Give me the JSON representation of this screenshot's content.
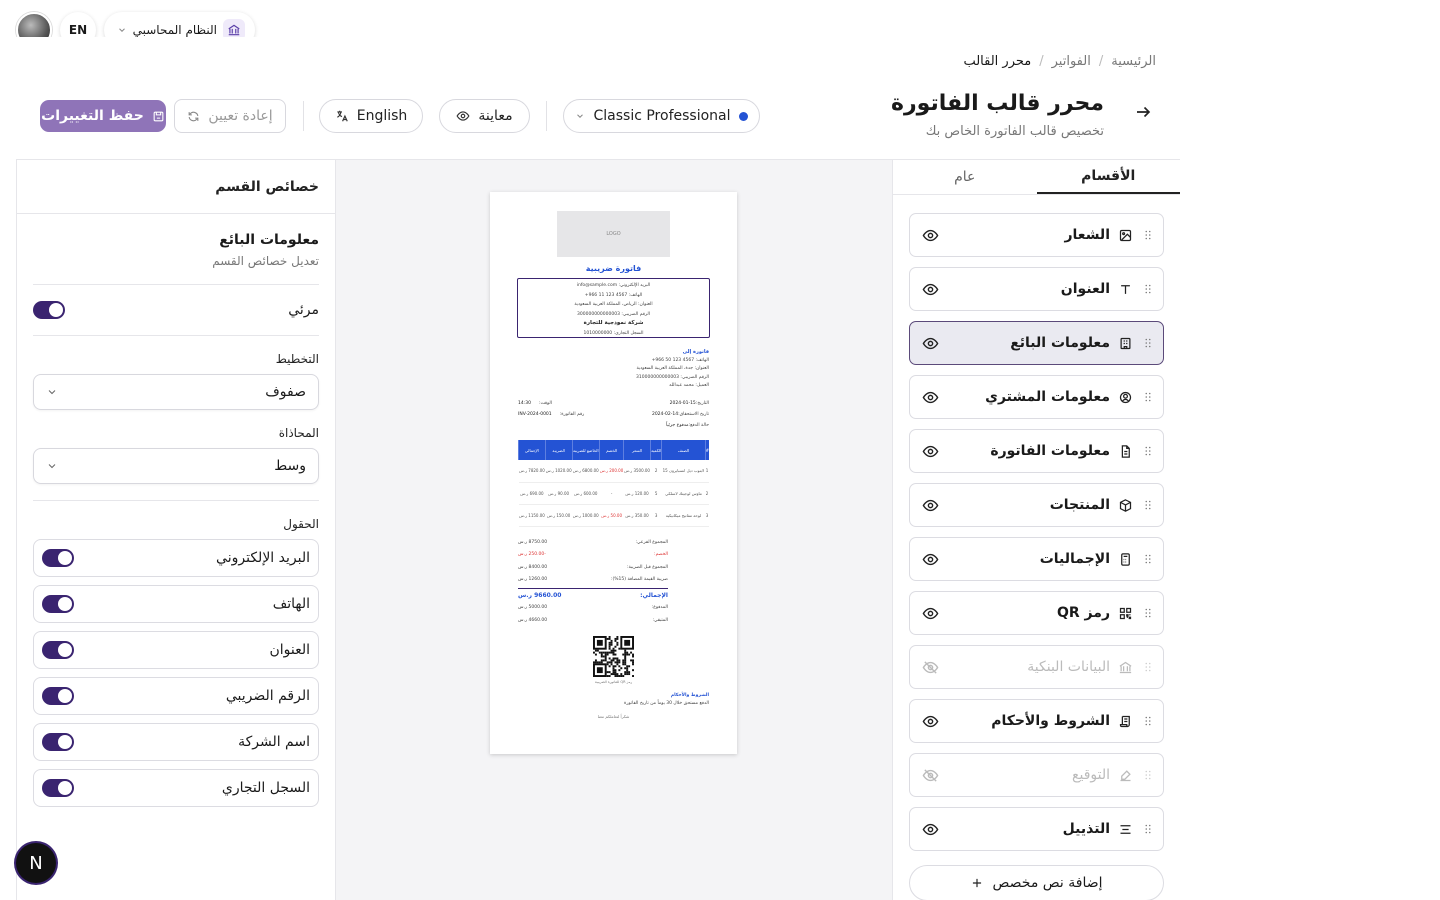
{
  "topbar": {
    "lang_code": "EN",
    "system_name": "النظام المحاسبي"
  },
  "breadcrumb": {
    "home": "الرئيسية",
    "invoices": "الفواتير",
    "current": "محرر القالب",
    "sep": "/"
  },
  "header": {
    "title": "محرر قالب الفاتورة",
    "subtitle": "تخصيص قالب الفاتورة الخاص بك"
  },
  "toolbar": {
    "template_name": "Classic Professional",
    "preview_label": "معاينة",
    "language_label": "English",
    "reset_label": "إعادة تعيين",
    "save_label": "حفظ التغييرات"
  },
  "colors": {
    "accent": "#3a2470",
    "primary_blue": "#2453d4",
    "save_bg": "#8f74b8"
  },
  "left_panel": {
    "header": "خصائص القسم",
    "section_title": "معلومات البائع",
    "section_sub": "تعديل خصائص القسم",
    "visible_label": "مرئي",
    "visible": true,
    "layout_label": "التخطيط",
    "layout_value": "صفوف",
    "align_label": "المحاذاة",
    "align_value": "وسط",
    "fields_label": "الحقول",
    "fields": [
      {
        "label": "البريد الإلكتروني",
        "on": true
      },
      {
        "label": "الهاتف",
        "on": true
      },
      {
        "label": "العنوان",
        "on": true
      },
      {
        "label": "الرقم الضريبي",
        "on": true
      },
      {
        "label": "اسم الشركة",
        "on": true
      },
      {
        "label": "السجل التجاري",
        "on": true
      }
    ]
  },
  "invoice": {
    "logo_text": "LOGO",
    "title": "فاتورة ضريبية",
    "seller": {
      "email": "البريد الإلكتروني: info@sample.com",
      "phone": "الهاتف: 4567 123 11 966+",
      "address": "العنوان: الرياض، المملكة العربية السعودية",
      "tax": "الرقم الضريبي: 300000000000003",
      "company": "شركة نموذجية للتجارة",
      "cr": "السجل التجاري: 1010000000"
    },
    "bill_to": {
      "heading": "فاتورة إلى",
      "phone": "الهاتف: 4567 123 50 966+",
      "address": "العنوان: جدة، المملكة العربية السعودية",
      "tax": "الرقم الضريبي: 310000000000003",
      "client": "العميل: محمد عبدالله"
    },
    "meta": [
      {
        "k": "التاريخ:",
        "v": "2024-01-15",
        "k2": "الوقت:",
        "v2": "14:30"
      },
      {
        "k": "تاريخ الاستحقاق:",
        "v": "2024-02-14",
        "k2": "رقم الفاتورة:",
        "v2": "INV-2024-0001"
      },
      {
        "k": "حالة الدفع:",
        "v": "مدفوع جزئياً",
        "k2": "",
        "v2": ""
      }
    ],
    "table_headers": [
      "#",
      "الصنف",
      "الكمية",
      "السعر",
      "الخصم",
      "الخاضع للضريبة",
      "الضريبة",
      "الإجمالي"
    ],
    "rows": [
      [
        "1",
        "لابتوب ديل انسبايرون 15",
        "2",
        "3500.00 ر.س",
        "200.00 ر.س",
        "6800.00 ر.س",
        "1020.00 ر.س",
        "7820.00 ر.س"
      ],
      [
        "2",
        "ماوس لوجيتك لاسلكي",
        "5",
        "120.00 ر.س",
        "-",
        "600.00 ر.س",
        "90.00 ر.س",
        "690.00 ر.س"
      ],
      [
        "3",
        "لوحة مفاتيح ميكانيكية",
        "3",
        "350.00 ر.س",
        "50.00 ر.س",
        "1000.00 ر.س",
        "150.00 ر.س",
        "1150.00 ر.س"
      ]
    ],
    "totals": [
      {
        "k": "المجموع الفرعي:",
        "v": "8750.00 ر.س"
      },
      {
        "k": "الخصم:",
        "v": "-250.00 ر.س"
      },
      {
        "k": "المجموع قبل الضريبة:",
        "v": "8400.00 ر.س"
      },
      {
        "k": "ضريبة القيمة المضافة (15%):",
        "v": "1260.00 ر.س"
      }
    ],
    "grand": {
      "k": "الإجمالي:",
      "v": "9660.00 ر.س"
    },
    "paid": {
      "k": "المدفوع:",
      "v": "5000.00 ر.س"
    },
    "remaining": {
      "k": "المتبقي:",
      "v": "4660.00 ر.س"
    },
    "qr_caption": "رمز QR للفاتورة الضريبية",
    "terms_heading": "الشروط والأحكام",
    "terms_text": "الدفع مستحق خلال 30 يوماً من تاريخ الفاتورة",
    "thanks": "شكراً لتعاملكم معنا"
  },
  "right_panel": {
    "tab_general": "عام",
    "tab_sections": "الأقسام",
    "sections": [
      {
        "label": "الشعار",
        "icon": "image-icon",
        "visible": true
      },
      {
        "label": "العنوان",
        "icon": "type-icon",
        "visible": true
      },
      {
        "label": "معلومات البائع",
        "icon": "building-icon",
        "visible": true,
        "selected": true
      },
      {
        "label": "معلومات المشتري",
        "icon": "user-circle-icon",
        "visible": true
      },
      {
        "label": "معلومات الفاتورة",
        "icon": "document-icon",
        "visible": true
      },
      {
        "label": "المنتجات",
        "icon": "box-icon",
        "visible": true
      },
      {
        "label": "الإجماليات",
        "icon": "calculator-icon",
        "visible": true
      },
      {
        "label": "رمز QR",
        "icon": "qr-icon",
        "visible": true
      },
      {
        "label": "البيانات البنكية",
        "icon": "bank-icon",
        "visible": false
      },
      {
        "label": "الشروط والأحكام",
        "icon": "scroll-icon",
        "visible": true
      },
      {
        "label": "التوقيع",
        "icon": "signature-icon",
        "visible": false
      },
      {
        "label": "التذييل",
        "icon": "align-icon",
        "visible": true
      }
    ],
    "add_custom_label": "إضافة نص مخصص"
  },
  "badge": {
    "letter": "N"
  }
}
